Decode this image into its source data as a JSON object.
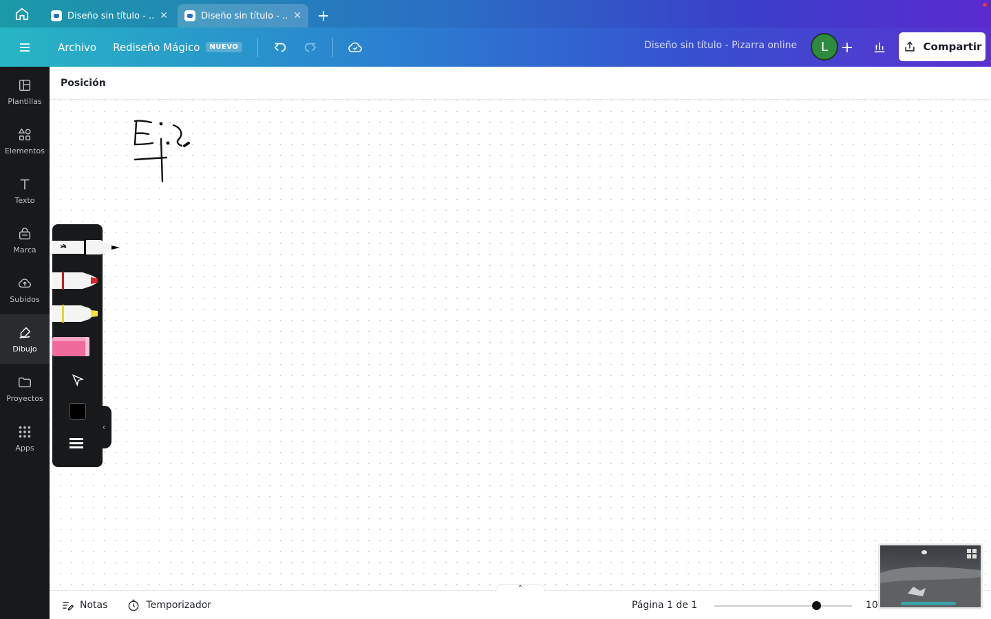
{
  "browser": {
    "tabs": [
      {
        "label": "Diseño sin título - ...",
        "active": false
      },
      {
        "label": "Diseño sin título - ...",
        "active": true
      }
    ]
  },
  "header": {
    "archivo": "Archivo",
    "magic": "Rediseño Mágico",
    "magic_badge": "NUEVO",
    "doc_title": "Diseño sin título - Pizarra online",
    "avatar_letter": "L",
    "share": "Compartir"
  },
  "sidebar": {
    "items": [
      {
        "label": "Plantillas",
        "icon": "templates-icon"
      },
      {
        "label": "Elementos",
        "icon": "elements-icon"
      },
      {
        "label": "Texto",
        "icon": "text-icon"
      },
      {
        "label": "Marca",
        "icon": "brand-icon"
      },
      {
        "label": "Subidos",
        "icon": "upload-icon"
      },
      {
        "label": "Dibujo",
        "icon": "draw-icon",
        "active": true
      },
      {
        "label": "Proyectos",
        "icon": "folder-icon"
      },
      {
        "label": "Apps",
        "icon": "apps-icon"
      }
    ]
  },
  "propbar": {
    "position": "Posición"
  },
  "draw_tools": {
    "pen_color": "#000000",
    "marker_color": "#e02424",
    "highlighter_color": "#f5e23b",
    "eraser_color": "#f06a9a",
    "selected_color": "#000000"
  },
  "footer": {
    "notes": "Notas",
    "timer": "Temporizador",
    "page": "Página 1 de 1",
    "zoom": "10"
  }
}
